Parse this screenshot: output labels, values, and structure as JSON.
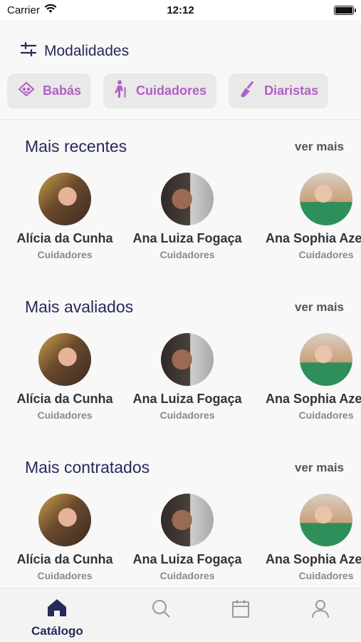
{
  "status_bar": {
    "carrier": "Carrier",
    "time": "12:12"
  },
  "modalidades": {
    "title": "Modalidades",
    "chips": [
      {
        "label": "Babás",
        "icon": "baby-icon"
      },
      {
        "label": "Cuidadores",
        "icon": "elderly-icon"
      },
      {
        "label": "Diaristas",
        "icon": "broom-icon"
      }
    ]
  },
  "sections": [
    {
      "title": "Mais recentes",
      "more": "ver mais",
      "profiles": [
        {
          "name": "Alícia da Cunha",
          "category": "Cuidadores"
        },
        {
          "name": "Ana Luiza Fogaça",
          "category": "Cuidadores"
        },
        {
          "name": "Ana Sophia Azevedo",
          "category": "Cuidadores"
        }
      ]
    },
    {
      "title": "Mais avaliados",
      "more": "ver mais",
      "profiles": [
        {
          "name": "Alícia da Cunha",
          "category": "Cuidadores"
        },
        {
          "name": "Ana Luiza Fogaça",
          "category": "Cuidadores"
        },
        {
          "name": "Ana Sophia Azevedo",
          "category": "Cuidadores"
        }
      ]
    },
    {
      "title": "Mais contratados",
      "more": "ver mais",
      "profiles": [
        {
          "name": "Alícia da Cunha",
          "category": "Cuidadores"
        },
        {
          "name": "Ana Luiza Fogaça",
          "category": "Cuidadores"
        },
        {
          "name": "Ana Sophia Azevedo",
          "category": "Cuidadores"
        }
      ]
    }
  ],
  "tab_bar": {
    "active_label": "Catálogo",
    "tabs": [
      "home-icon",
      "search-icon",
      "calendar-icon",
      "user-icon"
    ]
  },
  "colors": {
    "primary": "#262a5a",
    "accent": "#b35fc9",
    "chip_bg": "#e9e9e9"
  }
}
